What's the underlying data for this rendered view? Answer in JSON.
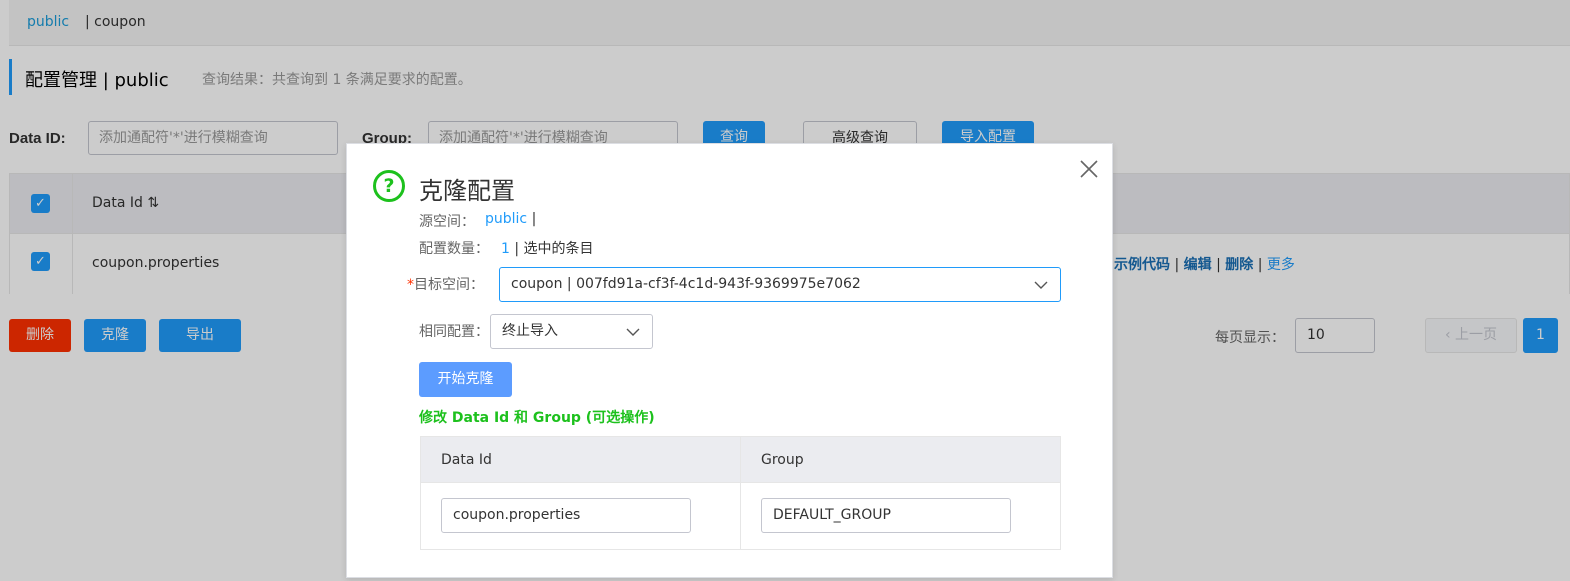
{
  "namespace_bar": {
    "public": "public",
    "coupon": "| coupon"
  },
  "header": {
    "title": "配置管理  |  public",
    "result": "查询结果：共查询到 1 条满足要求的配置。"
  },
  "search": {
    "dataid_label": "Data ID:",
    "dataid_placeholder": "添加通配符'*'进行模糊查询",
    "group_label": "Group:",
    "group_placeholder": "添加通配符'*'进行模糊查询",
    "query_btn": "查询",
    "advanced_btn": "高级查询",
    "import_btn": "导入配置"
  },
  "table": {
    "header_dataid": "Data Id",
    "row_dataid": "coupon.properties",
    "ops": {
      "sample": "示例代码",
      "sep": "|",
      "edit": "编辑",
      "delete": "删除",
      "more": "更多"
    }
  },
  "bulk": {
    "delete": "删除",
    "clone": "克隆",
    "export": "导出"
  },
  "pagination": {
    "page_size_label": "每页显示：",
    "page_size": "10",
    "prev": "上一页",
    "current": "1"
  },
  "dialog": {
    "title": "克隆配置",
    "source_label": "源空间：",
    "source_value": "public",
    "source_sep": "|",
    "count_label": "配置数量：",
    "count_value": "1",
    "count_suffix": "| 选中的条目",
    "required_mark": "*",
    "target_label": "目标空间：",
    "target_value": "coupon | 007fd91a-cf3f-4c1d-943f-9369975e7062",
    "same_label": "相同配置：",
    "same_value": "终止导入",
    "start_btn": "开始克隆",
    "hint": "修改 Data Id 和 Group (可选操作)",
    "col_dataid": "Data Id",
    "col_group": "Group",
    "row_dataid": "coupon.properties",
    "row_group": "DEFAULT_GROUP"
  },
  "colors": {
    "primary": "#209bfa",
    "danger": "#ff3000",
    "success": "#1dc11d"
  }
}
